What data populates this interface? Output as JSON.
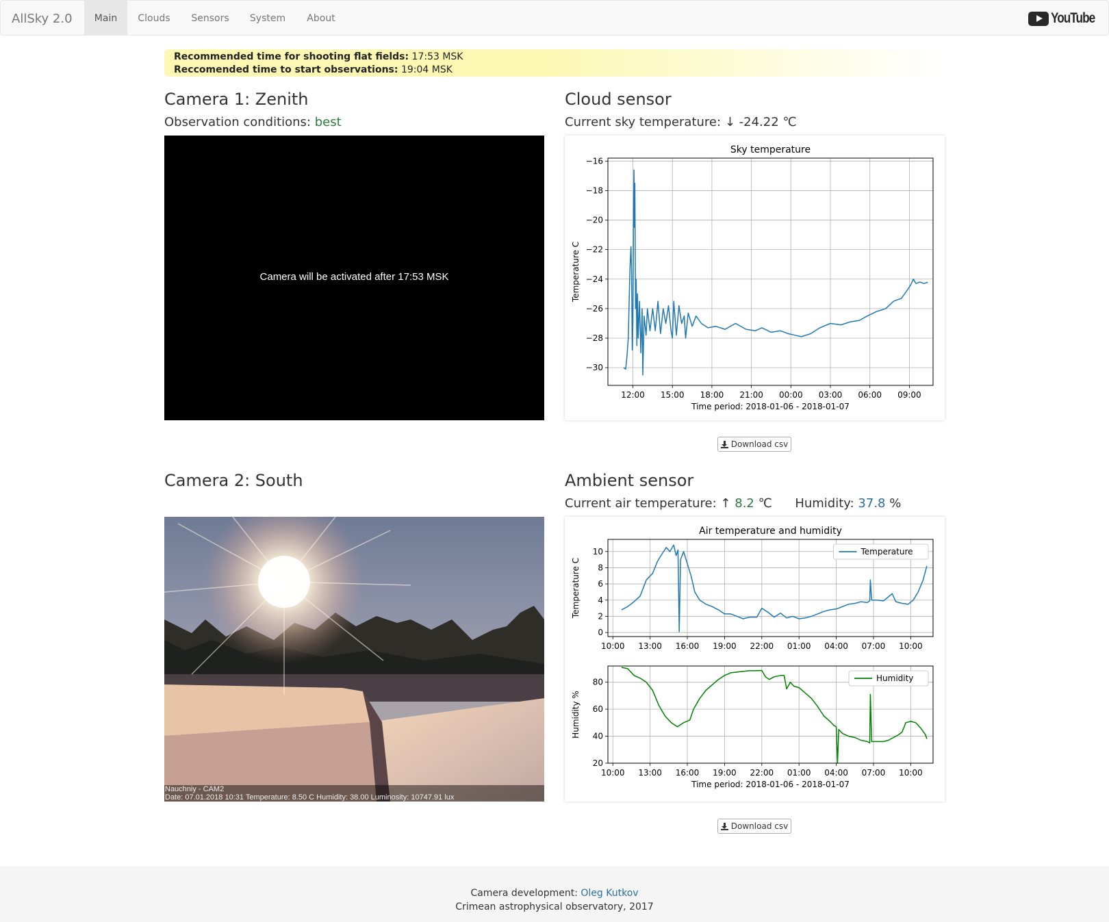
{
  "navbar": {
    "brand": "AllSky 2.0",
    "items": [
      {
        "label": "Main",
        "active": true
      },
      {
        "label": "Clouds",
        "active": false
      },
      {
        "label": "Sensors",
        "active": false
      },
      {
        "label": "System",
        "active": false
      },
      {
        "label": "About",
        "active": false
      }
    ],
    "youtube_label": "YouTube"
  },
  "alert": {
    "line1_label": "Recommended time for shooting flat fields:",
    "line1_value": "17:53 MSK",
    "line2_label": "Reccomended time to start observations:",
    "line2_value": "19:04 MSK"
  },
  "camera1": {
    "title": "Camera 1: Zenith",
    "conditions_label": "Observation conditions:",
    "conditions_value": "best",
    "message": "Camera will be activated after 17:53 MSK"
  },
  "camera2": {
    "title": "Camera 2: South",
    "overlay_line1": "Nauchniy - CAM2",
    "overlay_line2": "Date: 07.01.2018 10:31  Temperature: 8.50 C  Humidity: 38.00  Luminosity: 10747.91 lux"
  },
  "cloud_sensor": {
    "title": "Cloud sensor",
    "current_label": "Current sky temperature:",
    "arrow": "↓",
    "current_value": "-24.22",
    "unit": "℃",
    "download_label": "Download csv"
  },
  "ambient_sensor": {
    "title": "Ambient sensor",
    "air_label": "Current air temperature:",
    "air_arrow": "↑",
    "air_value": "8.2",
    "air_unit": "℃",
    "humidity_label": "Humidity:",
    "humidity_value": "37.8",
    "humidity_unit": "%",
    "download_label": "Download csv"
  },
  "footer": {
    "dev_label": "Camera development:",
    "dev_name": "Oleg Kutkov",
    "org": "Crimean astrophysical observatory, 2017"
  },
  "colors": {
    "temperature": "#1f77b4",
    "humidity": "#008000",
    "good": "#2d7a3b",
    "link": "#2a6fa0"
  },
  "chart_data": [
    {
      "type": "line",
      "title": "Sky temperature",
      "xlabel": "Time period: 2018-01-06 - 2018-01-07",
      "ylabel": "Temperature C",
      "x_ticks": [
        "12:00",
        "15:00",
        "18:00",
        "21:00",
        "00:00",
        "03:00",
        "06:00",
        "09:00"
      ],
      "y_ticks": [
        -16,
        -18,
        -20,
        -22,
        -24,
        -26,
        -28,
        -30
      ],
      "xlim": [
        10.1,
        34.8
      ],
      "ylim": [
        -31.2,
        -15.8
      ],
      "grid": true,
      "series": [
        {
          "color": "#1f77b4",
          "points": [
            [
              11.3,
              -30.0
            ],
            [
              11.45,
              -30.1
            ],
            [
              11.55,
              -29.2
            ],
            [
              11.65,
              -28.0
            ],
            [
              11.7,
              -26.0
            ],
            [
              11.78,
              -23.2
            ],
            [
              11.85,
              -21.8
            ],
            [
              11.9,
              -23.5
            ],
            [
              11.95,
              -28.8
            ],
            [
              12.0,
              -27.0
            ],
            [
              12.05,
              -19.5
            ],
            [
              12.08,
              -16.6
            ],
            [
              12.12,
              -20.5
            ],
            [
              12.15,
              -17.5
            ],
            [
              12.2,
              -26.0
            ],
            [
              12.25,
              -24.0
            ],
            [
              12.3,
              -28.5
            ],
            [
              12.35,
              -25.0
            ],
            [
              12.4,
              -28.0
            ],
            [
              12.5,
              -25.5
            ],
            [
              12.6,
              -29.0
            ],
            [
              12.7,
              -26.0
            ],
            [
              12.75,
              -30.5
            ],
            [
              12.85,
              -26.5
            ],
            [
              13.0,
              -27.8
            ],
            [
              13.1,
              -26.0
            ],
            [
              13.3,
              -27.5
            ],
            [
              13.5,
              -26.0
            ],
            [
              13.7,
              -27.5
            ],
            [
              13.9,
              -25.5
            ],
            [
              14.1,
              -27.7
            ],
            [
              14.3,
              -26.0
            ],
            [
              14.5,
              -27.0
            ],
            [
              14.7,
              -25.8
            ],
            [
              14.9,
              -27.5
            ],
            [
              15.0,
              -28.0
            ],
            [
              15.1,
              -25.5
            ],
            [
              15.3,
              -27.8
            ],
            [
              15.5,
              -25.8
            ],
            [
              15.7,
              -27.0
            ],
            [
              15.9,
              -26.5
            ],
            [
              16.0,
              -28.0
            ],
            [
              16.2,
              -26.3
            ],
            [
              16.5,
              -27.2
            ],
            [
              16.8,
              -26.5
            ],
            [
              17.2,
              -27.0
            ],
            [
              17.7,
              -27.3
            ],
            [
              18.3,
              -27.2
            ],
            [
              19.0,
              -27.4
            ],
            [
              19.8,
              -27.0
            ],
            [
              20.6,
              -27.4
            ],
            [
              21.3,
              -27.5
            ],
            [
              21.8,
              -27.3
            ],
            [
              22.5,
              -27.6
            ],
            [
              23.2,
              -27.5
            ],
            [
              23.8,
              -27.7
            ],
            [
              24.3,
              -27.8
            ],
            [
              24.8,
              -27.9
            ],
            [
              25.5,
              -27.7
            ],
            [
              26.2,
              -27.3
            ],
            [
              27.0,
              -27.0
            ],
            [
              27.8,
              -27.1
            ],
            [
              28.5,
              -26.9
            ],
            [
              29.2,
              -26.8
            ],
            [
              29.8,
              -26.5
            ],
            [
              30.5,
              -26.2
            ],
            [
              31.2,
              -26.0
            ],
            [
              31.8,
              -25.5
            ],
            [
              32.4,
              -25.3
            ],
            [
              32.8,
              -24.8
            ],
            [
              33.1,
              -24.4
            ],
            [
              33.3,
              -24.0
            ],
            [
              33.5,
              -24.3
            ],
            [
              33.8,
              -24.2
            ],
            [
              34.1,
              -24.3
            ],
            [
              34.4,
              -24.22
            ]
          ]
        }
      ]
    },
    {
      "type": "line",
      "title": "Air temperature and humidity",
      "ylabel": "Temperature C",
      "x_ticks": [
        "10:00",
        "13:00",
        "16:00",
        "19:00",
        "22:00",
        "01:00",
        "04:00",
        "07:00",
        "10:00"
      ],
      "y_ticks": [
        0,
        2,
        4,
        6,
        8,
        10
      ],
      "xlim": [
        9.6,
        35.8
      ],
      "ylim": [
        -0.5,
        11.5
      ],
      "grid": true,
      "legend": "upper-right",
      "series": [
        {
          "name": "Temperature",
          "color": "#1f77b4",
          "points": [
            [
              10.7,
              2.8
            ],
            [
              11.2,
              3.2
            ],
            [
              11.7,
              3.8
            ],
            [
              12.2,
              4.5
            ],
            [
              12.7,
              6.5
            ],
            [
              13.2,
              7.3
            ],
            [
              13.6,
              8.8
            ],
            [
              14.0,
              9.8
            ],
            [
              14.3,
              10.5
            ],
            [
              14.6,
              10.0
            ],
            [
              14.9,
              10.8
            ],
            [
              15.1,
              9.5
            ],
            [
              15.25,
              10.2
            ],
            [
              15.35,
              0.1
            ],
            [
              15.45,
              9.0
            ],
            [
              15.7,
              10.0
            ],
            [
              15.9,
              9.0
            ],
            [
              16.3,
              7.0
            ],
            [
              16.6,
              5.0
            ],
            [
              17.0,
              4.0
            ],
            [
              17.5,
              3.5
            ],
            [
              18.0,
              3.2
            ],
            [
              18.5,
              2.8
            ],
            [
              19.0,
              2.3
            ],
            [
              19.5,
              2.3
            ],
            [
              20.0,
              2.0
            ],
            [
              20.5,
              1.7
            ],
            [
              21.0,
              1.9
            ],
            [
              21.6,
              1.9
            ],
            [
              22.0,
              3.0
            ],
            [
              22.5,
              2.5
            ],
            [
              23.0,
              1.9
            ],
            [
              23.5,
              2.4
            ],
            [
              24.0,
              1.8
            ],
            [
              24.5,
              2.0
            ],
            [
              25.0,
              1.7
            ],
            [
              25.5,
              1.8
            ],
            [
              26.0,
              2.0
            ],
            [
              26.5,
              2.3
            ],
            [
              27.0,
              2.6
            ],
            [
              27.5,
              2.8
            ],
            [
              28.0,
              2.9
            ],
            [
              28.5,
              3.2
            ],
            [
              29.0,
              3.5
            ],
            [
              29.5,
              3.6
            ],
            [
              30.0,
              3.8
            ],
            [
              30.5,
              3.7
            ],
            [
              30.7,
              3.9
            ],
            [
              30.75,
              6.5
            ],
            [
              30.85,
              4.0
            ],
            [
              31.3,
              4.0
            ],
            [
              31.8,
              3.9
            ],
            [
              32.2,
              4.4
            ],
            [
              32.5,
              4.8
            ],
            [
              32.8,
              3.8
            ],
            [
              33.3,
              3.6
            ],
            [
              33.8,
              3.5
            ],
            [
              34.2,
              4.0
            ],
            [
              34.6,
              5.0
            ],
            [
              35.0,
              6.5
            ],
            [
              35.3,
              8.2
            ]
          ]
        }
      ]
    },
    {
      "type": "line",
      "xlabel": "Time period: 2018-01-06 - 2018-01-07",
      "ylabel": "Humidity %",
      "x_ticks": [
        "10:00",
        "13:00",
        "16:00",
        "19:00",
        "22:00",
        "01:00",
        "04:00",
        "07:00",
        "10:00"
      ],
      "y_ticks": [
        20,
        40,
        60,
        80
      ],
      "xlim": [
        9.6,
        35.8
      ],
      "ylim": [
        20,
        92
      ],
      "grid": true,
      "legend": "upper-right",
      "series": [
        {
          "name": "Humidity",
          "color": "#008000",
          "points": [
            [
              10.7,
              91
            ],
            [
              11.2,
              90
            ],
            [
              11.7,
              85
            ],
            [
              12.2,
              83
            ],
            [
              12.7,
              80
            ],
            [
              13.2,
              74
            ],
            [
              13.7,
              63
            ],
            [
              14.2,
              55
            ],
            [
              14.7,
              50
            ],
            [
              15.2,
              47
            ],
            [
              15.7,
              50
            ],
            [
              16.2,
              52
            ],
            [
              16.5,
              60
            ],
            [
              17.0,
              68
            ],
            [
              17.5,
              74
            ],
            [
              18.0,
              78
            ],
            [
              18.5,
              82
            ],
            [
              19.0,
              85
            ],
            [
              19.5,
              87
            ],
            [
              20.0,
              87.5
            ],
            [
              20.5,
              88
            ],
            [
              21.0,
              88.5
            ],
            [
              21.5,
              88.5
            ],
            [
              22.0,
              88.7
            ],
            [
              22.3,
              84
            ],
            [
              22.6,
              82
            ],
            [
              23.0,
              84
            ],
            [
              23.5,
              85
            ],
            [
              23.8,
              85
            ],
            [
              24.0,
              75
            ],
            [
              24.3,
              80
            ],
            [
              24.6,
              77
            ],
            [
              25.0,
              76
            ],
            [
              25.5,
              72
            ],
            [
              26.0,
              68
            ],
            [
              26.5,
              62
            ],
            [
              27.0,
              55
            ],
            [
              27.5,
              51
            ],
            [
              27.8,
              48
            ],
            [
              28.0,
              47
            ],
            [
              28.1,
              20
            ],
            [
              28.2,
              45
            ],
            [
              28.5,
              42
            ],
            [
              29.0,
              40
            ],
            [
              29.5,
              39
            ],
            [
              30.0,
              37
            ],
            [
              30.5,
              36
            ],
            [
              30.7,
              35
            ],
            [
              30.75,
              71
            ],
            [
              30.85,
              36
            ],
            [
              31.3,
              36
            ],
            [
              31.8,
              36
            ],
            [
              32.2,
              37
            ],
            [
              32.6,
              39
            ],
            [
              33.0,
              41
            ],
            [
              33.3,
              43
            ],
            [
              33.6,
              50
            ],
            [
              34.0,
              51
            ],
            [
              34.4,
              50
            ],
            [
              34.8,
              46
            ],
            [
              35.2,
              41
            ],
            [
              35.3,
              38
            ]
          ]
        }
      ]
    }
  ]
}
